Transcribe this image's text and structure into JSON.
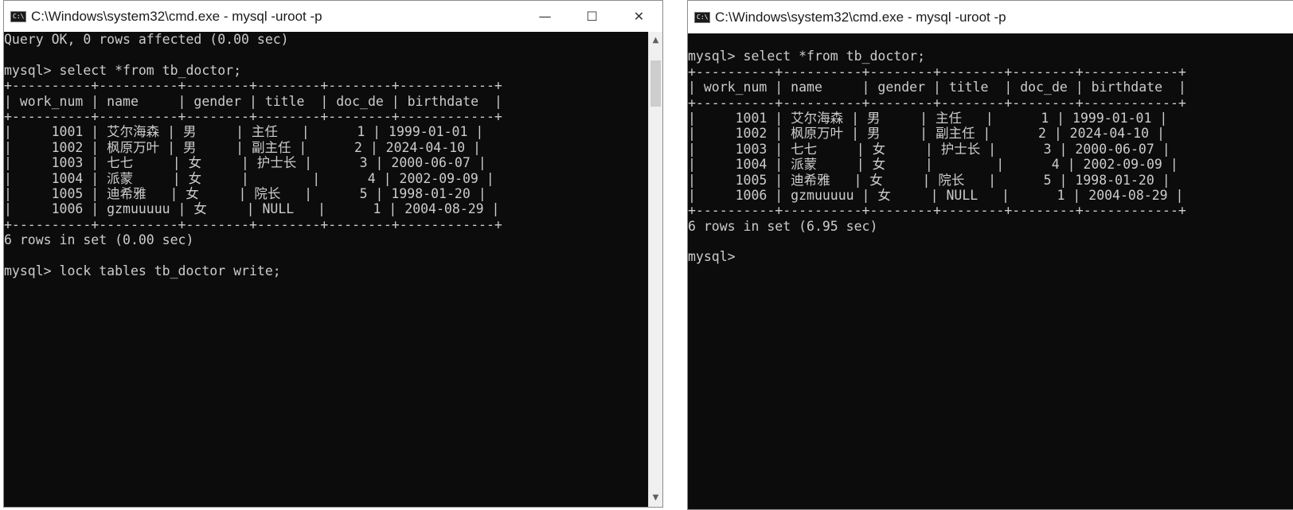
{
  "windows": [
    {
      "title": "C:\\Windows\\system32\\cmd.exe - mysql  -uroot -p",
      "controls": {
        "minimize": "—",
        "maximize": "☐",
        "close": "✕"
      },
      "lines": [
        "Query OK, 0 rows affected (0.00 sec)",
        "",
        "mysql> select *from tb_doctor;",
        "+----------+----------+--------+--------+--------+------------+",
        "| work_num | name     | gender | title  | doc_de | birthdate  |",
        "+----------+----------+--------+--------+--------+------------+",
        "|     1001 | 艾尔海森 | 男     | 主任   |      1 | 1999-01-01 |",
        "|     1002 | 枫原万叶 | 男     | 副主任 |      2 | 2024-04-10 |",
        "|     1003 | 七七     | 女     | 护士长 |      3 | 2000-06-07 |",
        "|     1004 | 派蒙     | 女     |        |      4 | 2002-09-09 |",
        "|     1005 | 迪希雅   | 女     | 院长   |      5 | 1998-01-20 |",
        "|     1006 | gzmuuuuu | 女     | NULL   |      1 | 2004-08-29 |",
        "+----------+----------+--------+--------+--------+------------+",
        "6 rows in set (0.00 sec)",
        "",
        "mysql> lock tables tb_doctor write;"
      ]
    },
    {
      "title": "C:\\Windows\\system32\\cmd.exe - mysql  -uroot -p",
      "lines": [
        "",
        "mysql> select *from tb_doctor;",
        "+----------+----------+--------+--------+--------+------------+",
        "| work_num | name     | gender | title  | doc_de | birthdate  |",
        "+----------+----------+--------+--------+--------+------------+",
        "|     1001 | 艾尔海森 | 男     | 主任   |      1 | 1999-01-01 |",
        "|     1002 | 枫原万叶 | 男     | 副主任 |      2 | 2024-04-10 |",
        "|     1003 | 七七     | 女     | 护士长 |      3 | 2000-06-07 |",
        "|     1004 | 派蒙     | 女     |        |      4 | 2002-09-09 |",
        "|     1005 | 迪希雅   | 女     | 院长   |      5 | 1998-01-20 |",
        "|     1006 | gzmuuuuu | 女     | NULL   |      1 | 2004-08-29 |",
        "+----------+----------+--------+--------+--------+------------+",
        "6 rows in set (6.95 sec)",
        "",
        "mysql>"
      ]
    }
  ],
  "app_icon_label": "C:\\",
  "scrollbar": {
    "up": "▲",
    "down": "▼"
  }
}
